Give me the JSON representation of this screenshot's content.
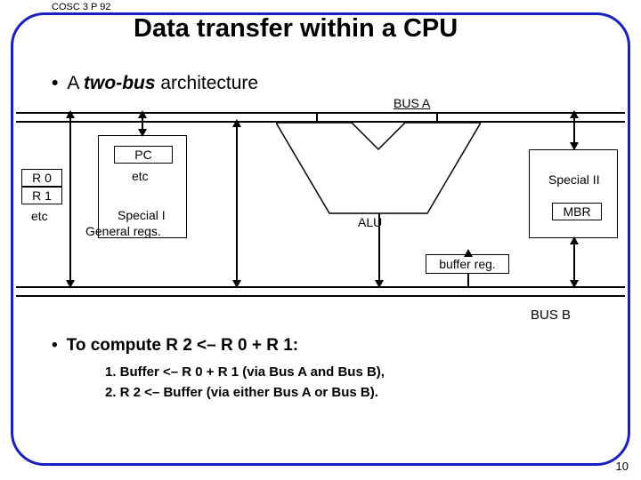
{
  "course": "COSC 3 P 92",
  "title": "Data transfer within a CPU",
  "subtitle_prefix": "A ",
  "subtitle_em": "two-bus",
  "subtitle_suffix": " architecture",
  "bus_a": "BUS A",
  "bus_b": "BUS B",
  "boxes": {
    "r0": "R 0",
    "r1": "R 1",
    "etc_left": "etc",
    "pc": "PC",
    "etc_mid": "etc",
    "special1": "Special I",
    "general": "General regs.",
    "alu": "ALU",
    "special2": "Special II",
    "mbr": "MBR",
    "buffer": "buffer reg."
  },
  "compute_heading": "To compute R 2 <– R 0 + R 1:",
  "step1": "1. Buffer <– R 0 + R 1 (via Bus A and Bus B),",
  "step2": "2. R 2 <– Buffer (via either Bus A or Bus B).",
  "page": "10"
}
